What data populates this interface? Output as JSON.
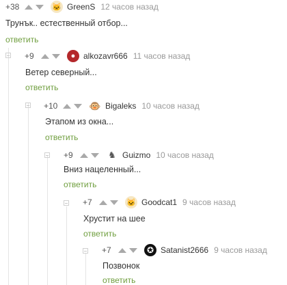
{
  "comments": [
    {
      "score": "+38",
      "author": "GreenS",
      "time": "12 часов назад",
      "text": "Трунък.. естественный отбор...",
      "reply": "ответить",
      "avatar_icon": "cat-avatar"
    },
    {
      "score": "+9",
      "author": "alkozavr666",
      "time": "11 часов назад",
      "text": "Ветер северный...",
      "reply": "ответить",
      "avatar_icon": "red-avatar"
    },
    {
      "score": "+10",
      "author": "Bigaleks",
      "time": "10 часов назад",
      "text": "Этапом из окна...",
      "reply": "ответить",
      "avatar_icon": "monkey-avatar"
    },
    {
      "score": "+9",
      "author": "Guizmo",
      "time": "10 часов назад",
      "text": "Вниз нацеленный...",
      "reply": "ответить",
      "avatar_icon": "pixel-avatar"
    },
    {
      "score": "+7",
      "author": "Goodcat1",
      "time": "9 часов назад",
      "text": "Хрустит на шее",
      "reply": "ответить",
      "avatar_icon": "cat-avatar"
    },
    {
      "score": "+7",
      "author": "Satanist2666",
      "time": "9 часов назад",
      "text": "Позвонок",
      "reply": "ответить",
      "avatar_icon": "pentagram-avatar"
    }
  ]
}
